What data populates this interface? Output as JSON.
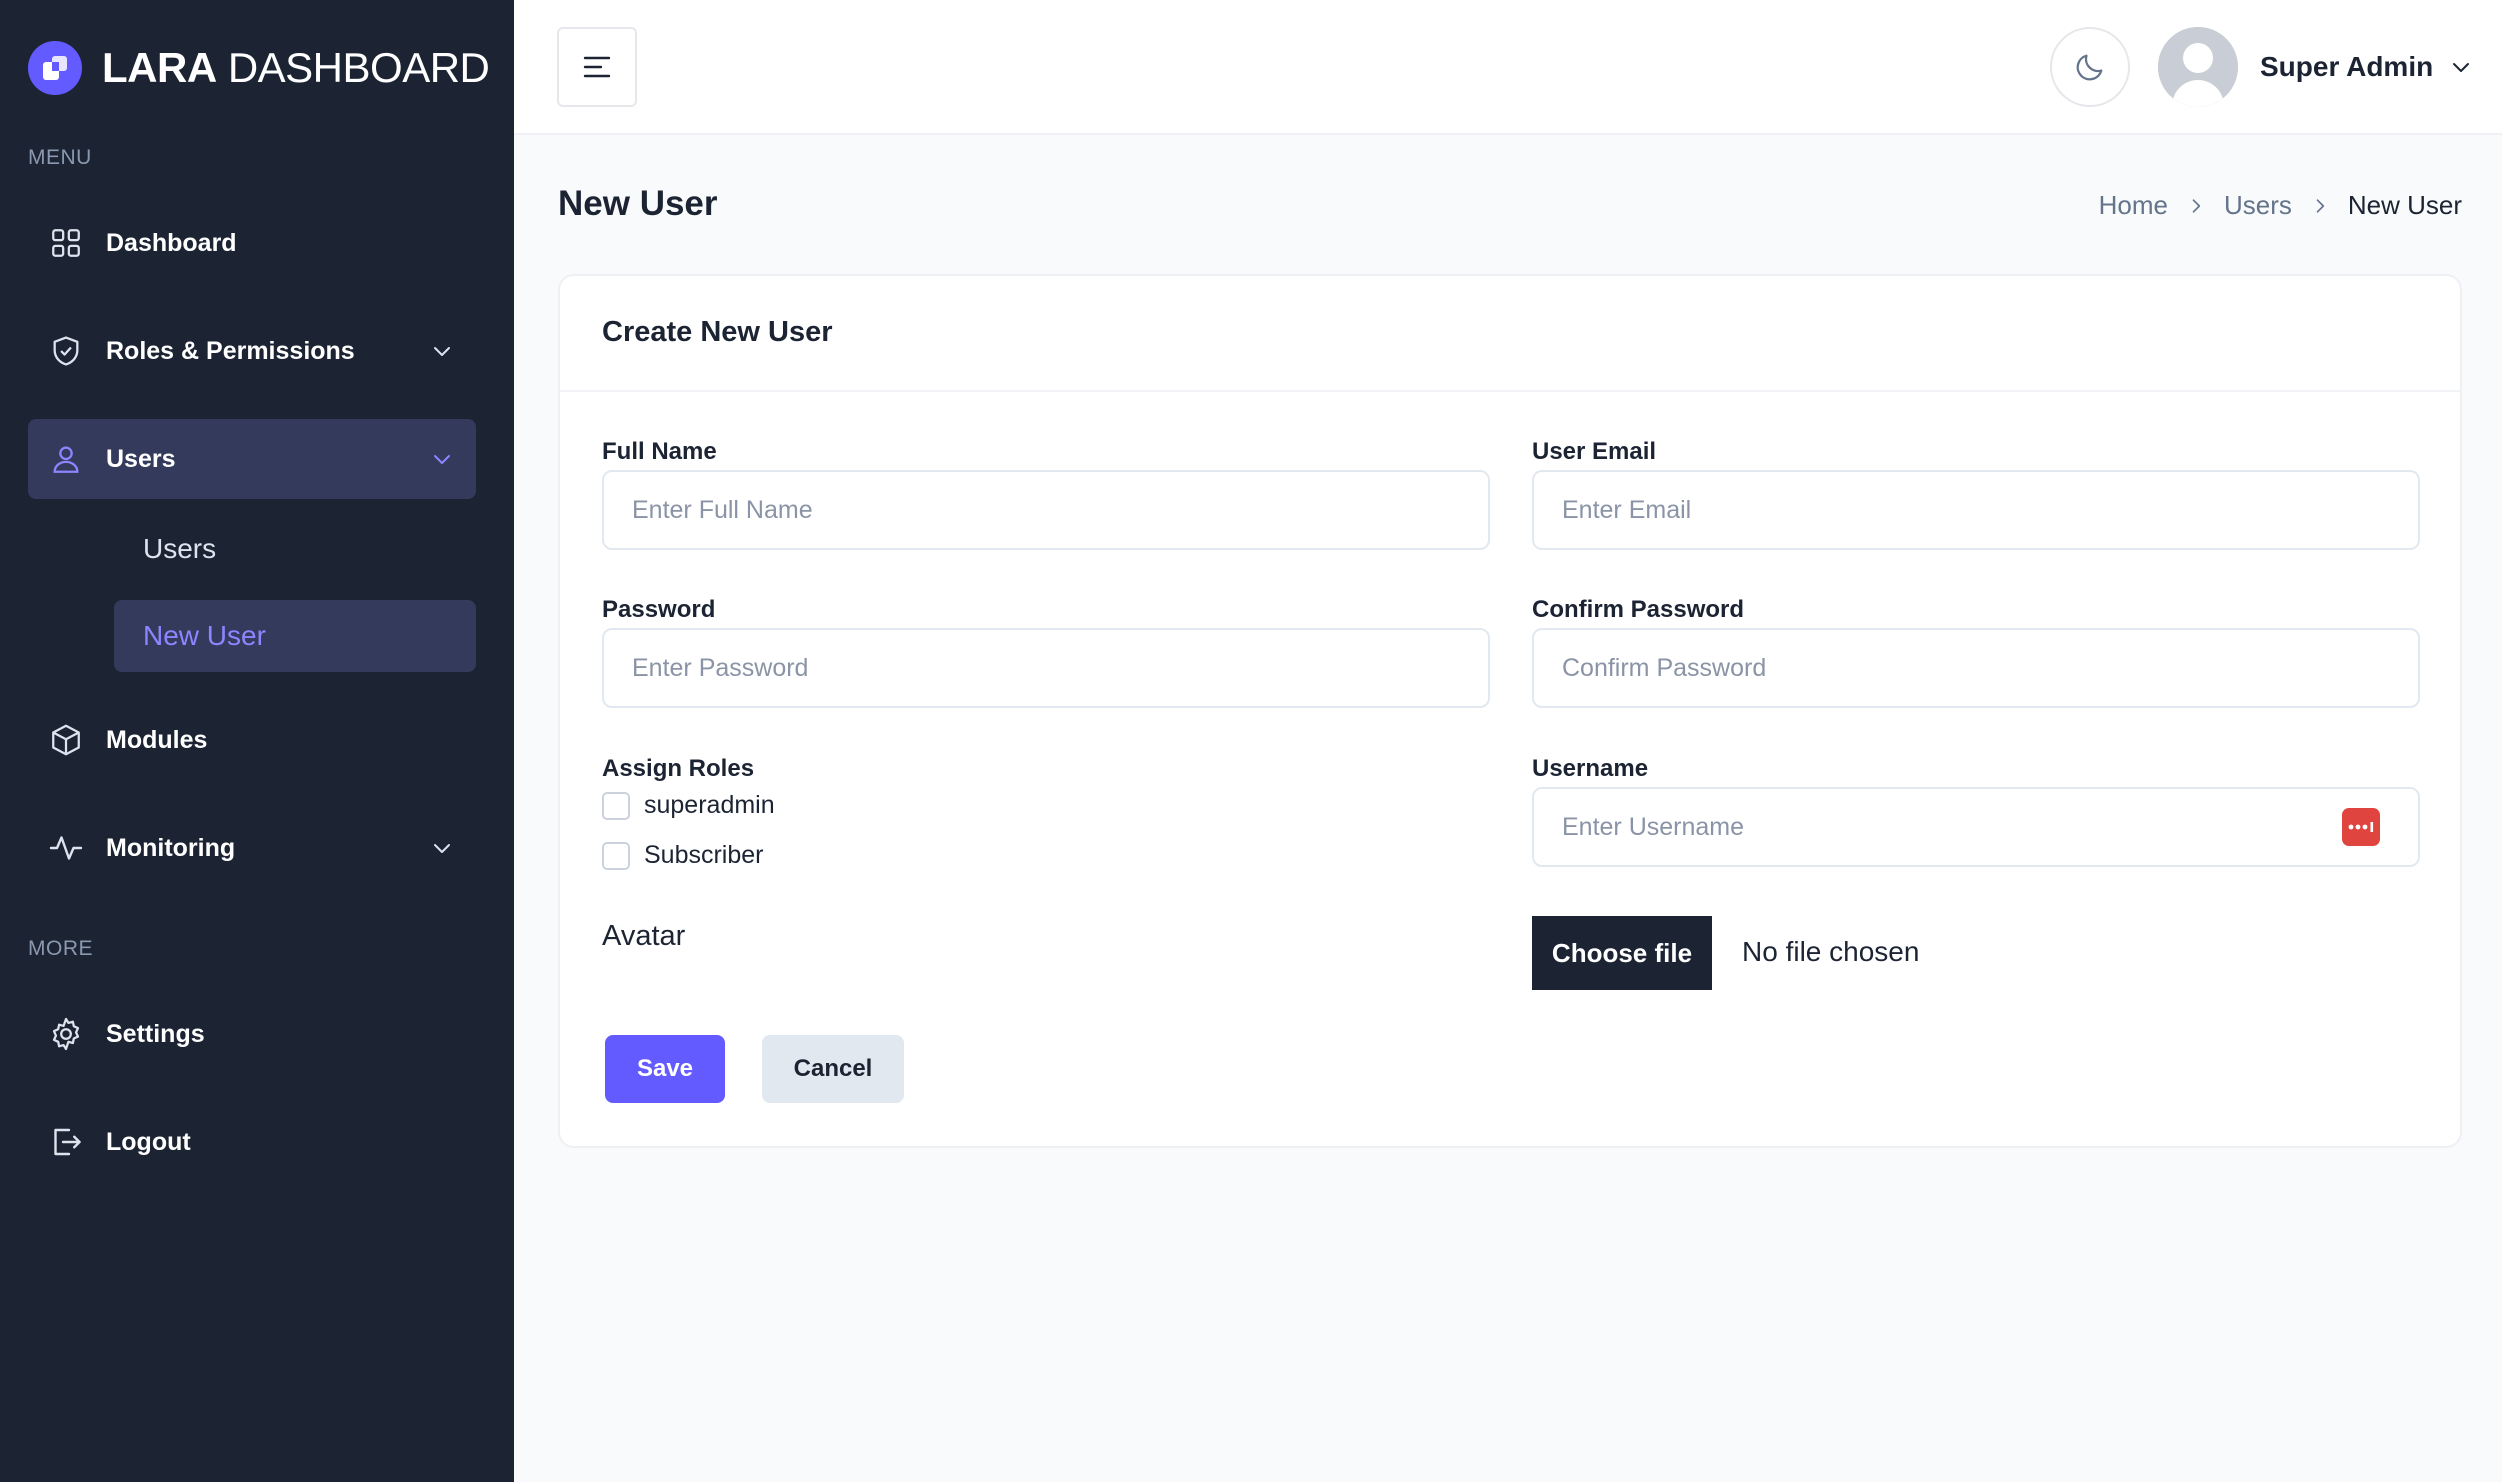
{
  "brand": {
    "name_bold": "LARA",
    "name_rest": " DASHBOARD",
    "accent": "#635bff"
  },
  "sidebar": {
    "menu_label": "MENU",
    "more_label": "MORE",
    "items": [
      {
        "label": "Dashboard",
        "icon": "grid-icon"
      },
      {
        "label": "Roles & Permissions",
        "icon": "shield-icon"
      },
      {
        "label": "Users",
        "icon": "user-icon"
      },
      {
        "label": "Modules",
        "icon": "cube-icon"
      },
      {
        "label": "Monitoring",
        "icon": "activity-icon"
      },
      {
        "label": "Settings",
        "icon": "gear-icon"
      },
      {
        "label": "Logout",
        "icon": "logout-icon"
      }
    ],
    "users_submenu": [
      {
        "label": "Users"
      },
      {
        "label": "New User"
      }
    ]
  },
  "header": {
    "user_name": "Super Admin"
  },
  "page": {
    "title": "New User",
    "breadcrumb": [
      "Home",
      "Users",
      "New User"
    ]
  },
  "form": {
    "card_title": "Create New User",
    "full_name": {
      "label": "Full Name",
      "placeholder": "Enter Full Name",
      "value": ""
    },
    "email": {
      "label": "User Email",
      "placeholder": "Enter Email",
      "value": ""
    },
    "password": {
      "label": "Password",
      "placeholder": "Enter Password",
      "value": ""
    },
    "confirm_password": {
      "label": "Confirm Password",
      "placeholder": "Confirm Password",
      "value": ""
    },
    "roles": {
      "label": "Assign Roles",
      "options": [
        "superadmin",
        "Subscriber"
      ]
    },
    "username": {
      "label": "Username",
      "placeholder": "Enter Username",
      "value": ""
    },
    "avatar": {
      "label": "Avatar",
      "button": "Choose file",
      "status": "No file chosen"
    },
    "save_label": "Save",
    "cancel_label": "Cancel"
  }
}
